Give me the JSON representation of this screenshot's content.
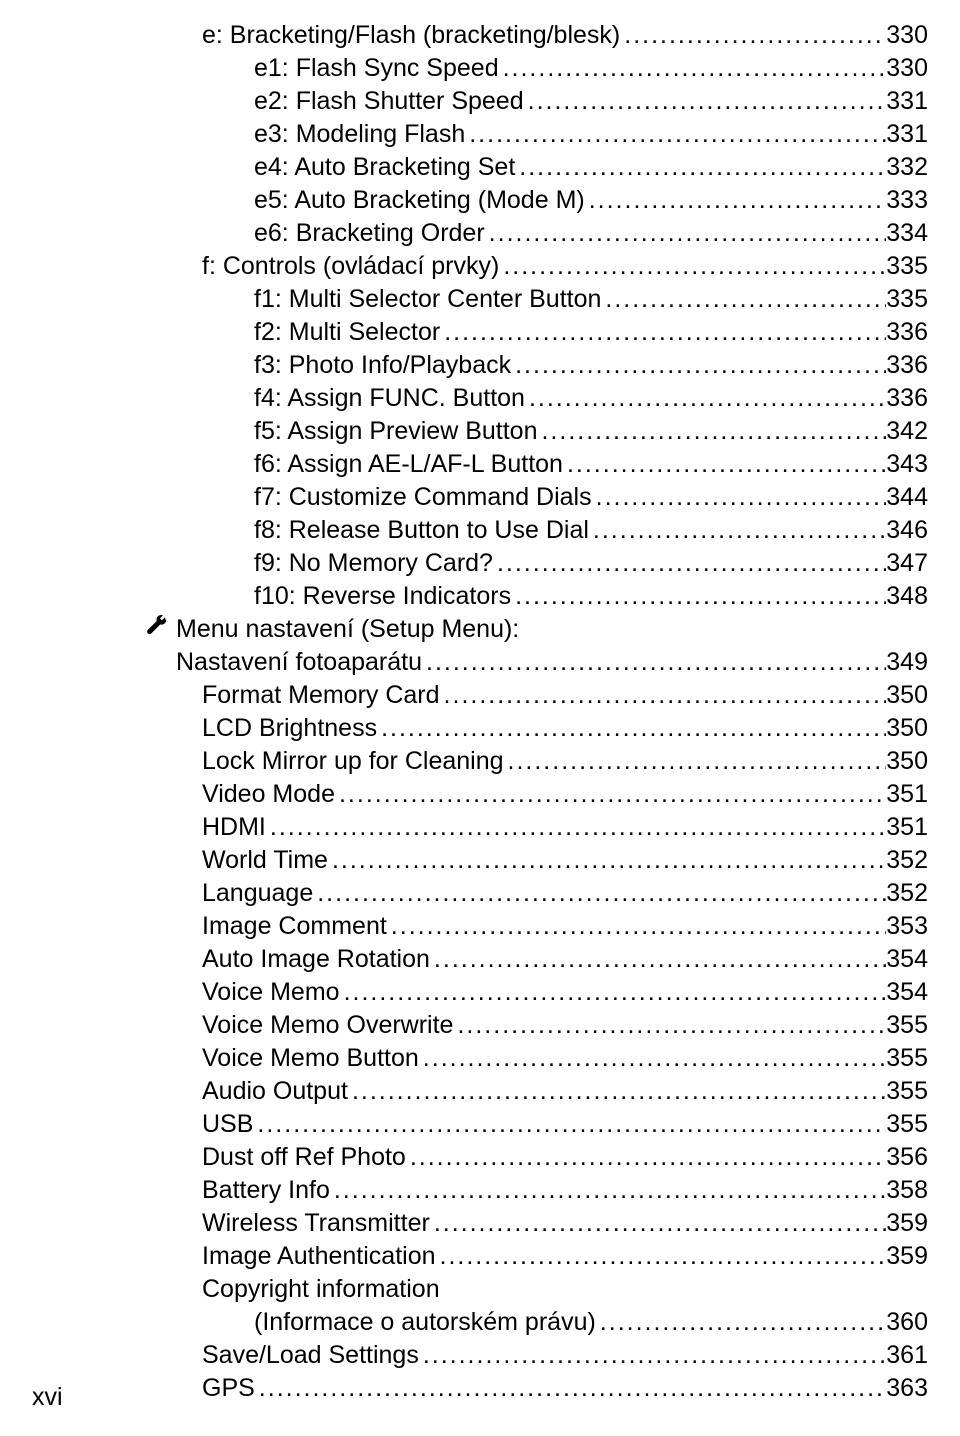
{
  "page_number_label": "xvi",
  "entries": [
    {
      "indent": 2,
      "label": "e: Bracketing/Flash (bracketing/blesk)",
      "page": "330"
    },
    {
      "indent": 3,
      "label": "e1: Flash Sync Speed",
      "page": "330"
    },
    {
      "indent": 3,
      "label": "e2: Flash Shutter Speed",
      "page": "331"
    },
    {
      "indent": 3,
      "label": "e3: Modeling Flash",
      "page": "331"
    },
    {
      "indent": 3,
      "label": "e4: Auto Bracketing Set",
      "page": "332"
    },
    {
      "indent": 3,
      "label": "e5: Auto Bracketing (Mode M)",
      "page": "333"
    },
    {
      "indent": 3,
      "label": "e6: Bracketing Order",
      "page": "334"
    },
    {
      "indent": 2,
      "label": "f: Controls (ovládací prvky)",
      "page": "335"
    },
    {
      "indent": 3,
      "label": "f1: Multi Selector Center Button",
      "page": "335"
    },
    {
      "indent": 3,
      "label": "f2: Multi Selector",
      "page": "336"
    },
    {
      "indent": 3,
      "label": "f3: Photo Info/Playback",
      "page": "336"
    },
    {
      "indent": 3,
      "label": "f4: Assign FUNC. Button",
      "page": "336"
    },
    {
      "indent": 3,
      "label": "f5: Assign Preview Button",
      "page": "342"
    },
    {
      "indent": 3,
      "label": "f6: Assign AE-L/AF-L Button",
      "page": "343"
    },
    {
      "indent": 3,
      "label": "f7: Customize Command Dials",
      "page": "344"
    },
    {
      "indent": 3,
      "label": "f8: Release Button to Use Dial",
      "page": "346"
    },
    {
      "indent": 3,
      "label": "f9: No Memory Card?",
      "page": "347"
    },
    {
      "indent": 3,
      "label": "f10: Reverse Indicators",
      "page": "348"
    },
    {
      "indent": 1,
      "icon": "wrench",
      "label": "Menu nastavení (Setup Menu):",
      "page": ""
    },
    {
      "indent": 1,
      "label": "Nastavení fotoaparátu",
      "page": "349",
      "continue": true
    },
    {
      "indent": 2,
      "label": "Format Memory Card",
      "page": "350"
    },
    {
      "indent": 2,
      "label": "LCD Brightness",
      "page": "350"
    },
    {
      "indent": 2,
      "label": "Lock Mirror up for Cleaning",
      "page": "350"
    },
    {
      "indent": 2,
      "label": "Video Mode",
      "page": "351"
    },
    {
      "indent": 2,
      "label": "HDMI",
      "page": "351"
    },
    {
      "indent": 2,
      "label": "World Time",
      "page": "352"
    },
    {
      "indent": 2,
      "label": "Language",
      "page": "352"
    },
    {
      "indent": 2,
      "label": "Image Comment",
      "page": "353"
    },
    {
      "indent": 2,
      "label": "Auto Image Rotation",
      "page": "354"
    },
    {
      "indent": 2,
      "label": "Voice Memo",
      "page": "354"
    },
    {
      "indent": 2,
      "label": "Voice Memo Overwrite",
      "page": "355"
    },
    {
      "indent": 2,
      "label": "Voice Memo Button",
      "page": "355"
    },
    {
      "indent": 2,
      "label": "Audio Output",
      "page": "355"
    },
    {
      "indent": 2,
      "label": "USB",
      "page": "355"
    },
    {
      "indent": 2,
      "label": "Dust off Ref Photo",
      "page": "356"
    },
    {
      "indent": 2,
      "label": "Battery Info",
      "page": "358"
    },
    {
      "indent": 2,
      "label": "Wireless Transmitter",
      "page": "359"
    },
    {
      "indent": 2,
      "label": "Image Authentication",
      "page": "359"
    },
    {
      "indent": 2,
      "label": "Copyright information",
      "page": ""
    },
    {
      "indent": 2,
      "label": "(Informace o autorském právu)",
      "page": "360",
      "extra": true
    },
    {
      "indent": 2,
      "label": "Save/Load Settings",
      "page": "361"
    },
    {
      "indent": 2,
      "label": "GPS",
      "page": "363"
    }
  ]
}
